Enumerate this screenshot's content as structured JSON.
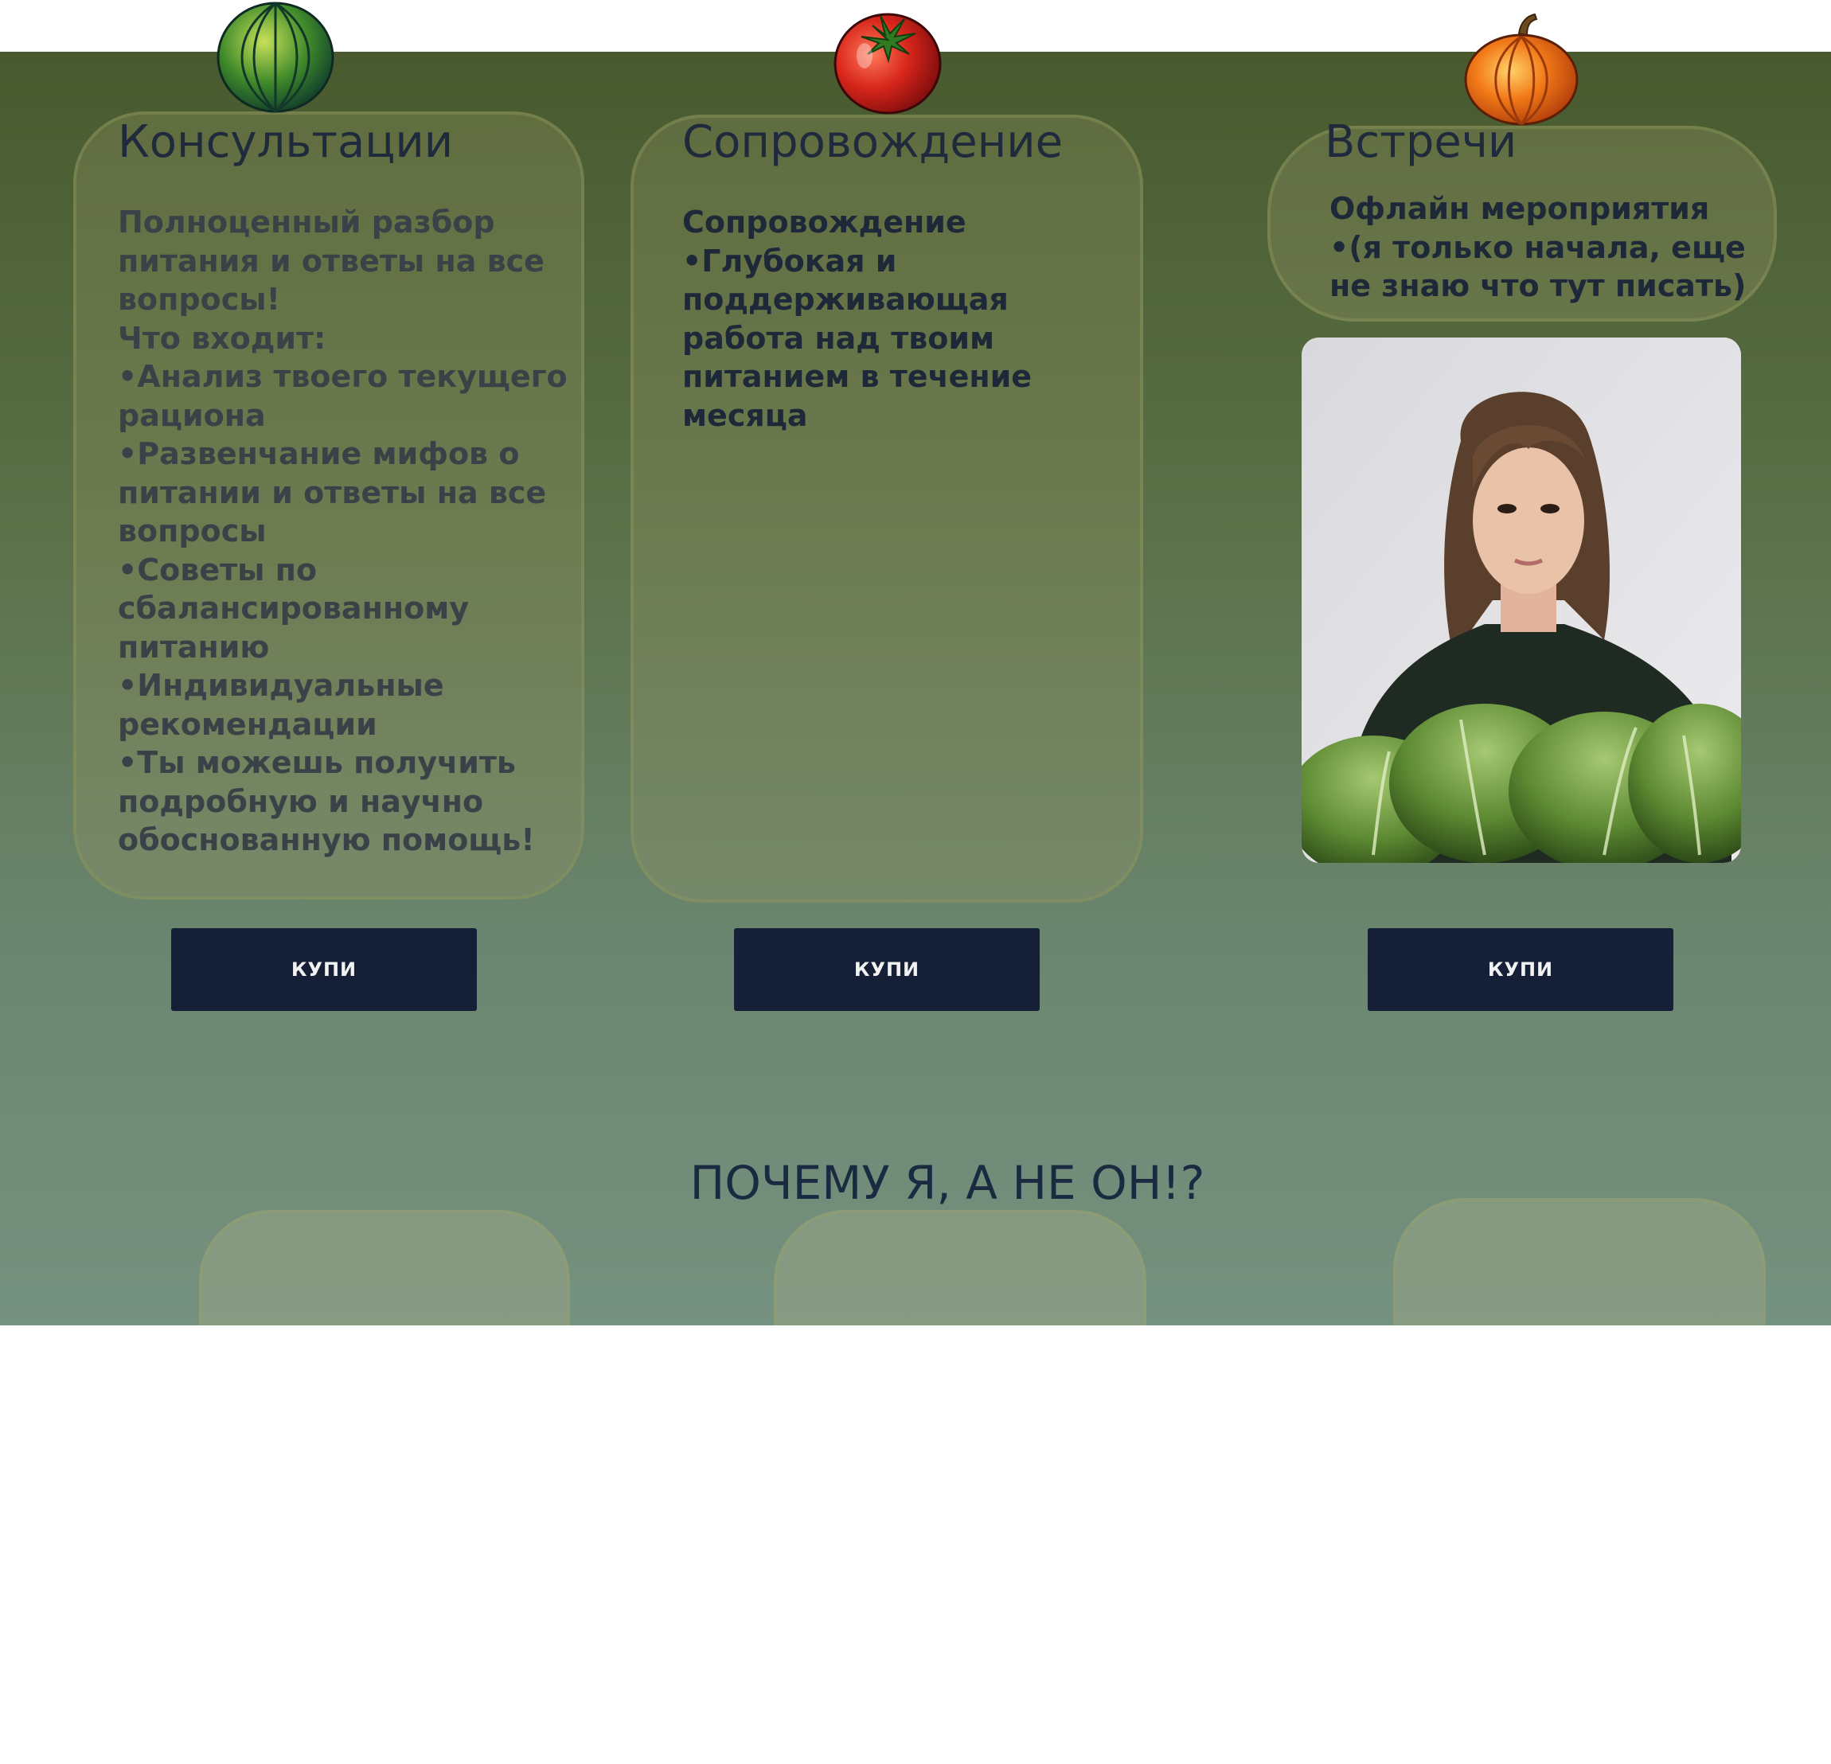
{
  "services": [
    {
      "title": "Консультации",
      "lines": [
        "Полноценный разбор",
        "питания и ответы на все",
        "вопросы!",
        "Что входит:",
        "•Анализ твоего текущего",
        "рациона",
        "•Развенчание мифов о",
        "питании и ответы на все",
        "вопросы",
        "•Советы по",
        "сбалансированному",
        "питанию",
        "•Индивидуальные",
        "рекомендации",
        "•Ты можешь получить",
        "подробную и научно",
        "обоснованную помощь!"
      ],
      "button": "КУПИ",
      "icon": "melon-icon"
    },
    {
      "title": "Сопровождение",
      "lines": [
        "Сопровождение",
        "•Глубокая и",
        "поддерживающая",
        "работа над твоим",
        "питанием в течение",
        "месяца"
      ],
      "button": "КУПИ",
      "icon": "tomato-icon"
    },
    {
      "title": "Встречи",
      "lines": [
        "Офлайн мероприятия",
        "•(я только начала, еще",
        "не знаю что тут писать)"
      ],
      "button": "КУПИ",
      "icon": "pumpkin-icon"
    }
  ],
  "why_heading": "ПОЧЕМУ Я, А НЕ ОН!?",
  "colors": {
    "button_bg": "#151f36",
    "heading": "#1f2b3c",
    "gradient_top": "#485a2e",
    "gradient_bottom": "#75917f"
  }
}
